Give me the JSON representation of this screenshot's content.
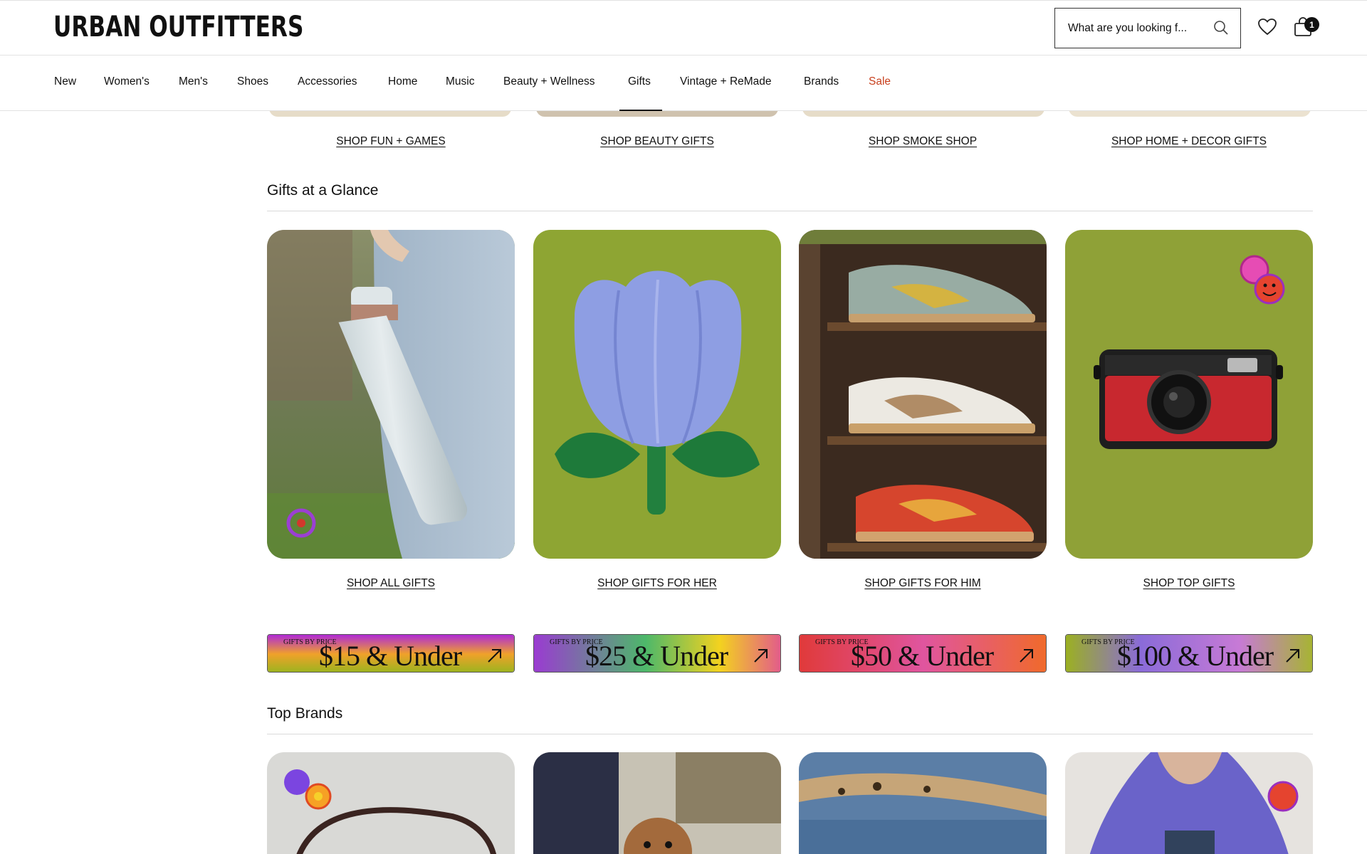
{
  "header": {
    "logo": "URBAN OUTFITTERS",
    "search_placeholder": "What are you looking f...",
    "cart_count": "1"
  },
  "nav": {
    "items": [
      "New",
      "Women's",
      "Men's",
      "Shoes",
      "Accessories",
      "Home",
      "Music",
      "Beauty + Wellness",
      "Gifts",
      "Vintage + ReMade",
      "Brands",
      "Sale"
    ],
    "active": "Gifts",
    "sale_color": "#c8401e"
  },
  "top_links": [
    "SHOP FUN + GAMES",
    "SHOP BEAUTY GIFTS",
    "SHOP SMOKE SHOP",
    "SHOP HOME + DECOR GIFTS"
  ],
  "glance": {
    "title": "Gifts at a Glance",
    "cards": [
      {
        "link": "SHOP ALL GIFTS",
        "icon": "water-bottle"
      },
      {
        "link": "SHOP GIFTS FOR HER",
        "icon": "tulip-pillow"
      },
      {
        "link": "SHOP GIFTS FOR HIM",
        "icon": "sneakers"
      },
      {
        "link": "SHOP TOP GIFTS",
        "icon": "camera"
      }
    ],
    "card_bg_green": "#8ea533"
  },
  "price_banners": [
    {
      "tag": "GIFTS BY PRICE",
      "amount": "$15 & Under"
    },
    {
      "tag": "GIFTS BY PRICE",
      "amount": "$25 & Under"
    },
    {
      "tag": "GIFTS BY PRICE",
      "amount": "$50 & Under"
    },
    {
      "tag": "GIFTS BY PRICE",
      "amount": "$100 & Under"
    }
  ],
  "brands": {
    "title": "Top Brands"
  }
}
